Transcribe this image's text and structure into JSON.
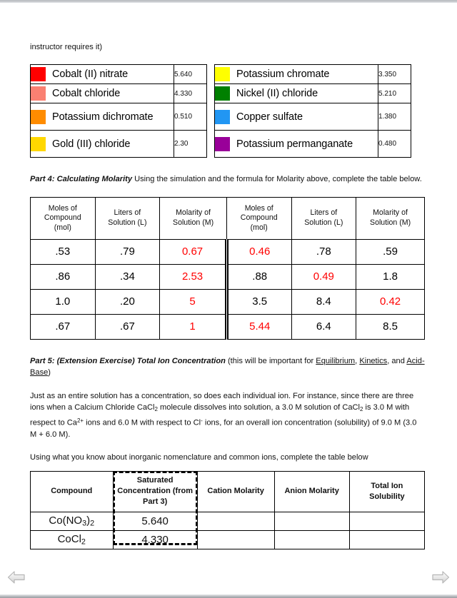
{
  "document": {
    "top_fragment_text": "instructor requires it)"
  },
  "legend_table": {
    "left_rows": [
      {
        "color": "#FF0000",
        "name": "Cobalt (II) nitrate",
        "value": "5.640",
        "tall": false
      },
      {
        "color": "#FA8072",
        "name": "Cobalt chloride",
        "value": "4.330",
        "tall": false
      },
      {
        "color": "#FF8C00",
        "name": "Potassium dichromate",
        "value": "0.510",
        "tall": true
      },
      {
        "color": "#FFD700",
        "name": "Gold (III) chloride",
        "value": "2.30",
        "tall": true
      }
    ],
    "right_rows": [
      {
        "color": "#FFFF00",
        "name": "Potassium chromate",
        "value": "3.350",
        "tall": false
      },
      {
        "color": "#008000",
        "name": "Nickel (II) chloride",
        "value": "5.210",
        "tall": false
      },
      {
        "color": "#2196F3",
        "name": "Copper sulfate",
        "value": "1.380",
        "tall": true
      },
      {
        "color": "#990099",
        "name": "Potassium permanganate",
        "value": "0.480",
        "tall": true
      }
    ]
  },
  "part4": {
    "heading": "Part 4: Calculating Molarity",
    "body": " Using the simulation and the formula for Molarity above, complete the table below.",
    "columns": [
      "Moles of Compound (mol)",
      "Liters of Solution (L)",
      "Molarity of Solution (M)",
      "Moles of Compound (mol)",
      "Liters of Solution (L)",
      "Molarity of Solution (M)"
    ],
    "column_lines": [
      [
        "Moles of",
        "Compound",
        "(mol)"
      ],
      [
        "Liters of",
        "Solution (L)"
      ],
      [
        "Molarity of",
        "Solution (M)"
      ],
      [
        "Moles of",
        "Compound",
        "(mol)"
      ],
      [
        "Liters of",
        "Solution (L)"
      ],
      [
        "Molarity of",
        "Solution (M)"
      ]
    ],
    "rows": [
      [
        {
          "v": ".53",
          "red": false
        },
        {
          "v": ".79",
          "red": false
        },
        {
          "v": "0.67",
          "red": true
        },
        {
          "v": "0.46",
          "red": true
        },
        {
          "v": ".78",
          "red": false
        },
        {
          "v": ".59",
          "red": false
        }
      ],
      [
        {
          "v": ".86",
          "red": false
        },
        {
          "v": ".34",
          "red": false
        },
        {
          "v": "2.53",
          "red": true
        },
        {
          "v": ".88",
          "red": false
        },
        {
          "v": "0.49",
          "red": true
        },
        {
          "v": "1.8",
          "red": false
        }
      ],
      [
        {
          "v": "1.0",
          "red": false
        },
        {
          "v": ".20",
          "red": false
        },
        {
          "v": "5",
          "red": true
        },
        {
          "v": "3.5",
          "red": false
        },
        {
          "v": "8.4",
          "red": false
        },
        {
          "v": "0.42",
          "red": true
        }
      ],
      [
        {
          "v": ".67",
          "red": false
        },
        {
          "v": ".67",
          "red": false
        },
        {
          "v": "1",
          "red": true
        },
        {
          "v": "5.44",
          "red": true
        },
        {
          "v": "6.4",
          "red": false
        },
        {
          "v": "8.5",
          "red": false
        }
      ]
    ],
    "red_color": "#FF0000"
  },
  "part5": {
    "heading": "Part 5: (Extension Exercise) Total Ion Concentration",
    "heading_tail_1": " (this will be important for ",
    "link_equilibrium": "Equilibrium",
    "sep_1": ", ",
    "link_kinetics": "Kinetics",
    "sep_2": ", and ",
    "link_acid_base": "Acid-Base",
    "heading_tail_2": ")",
    "paragraph_1_a": "Just as an entire solution has a concentration, so does each individual ion.  For instance, since there are three ions when a Calcium Chloride CaCl",
    "paragraph_1_sub1": "2",
    "paragraph_1_b": " molecule dissolves into solution, a 3.0 M solution of CaCl",
    "paragraph_1_sub2": "2",
    "paragraph_1_c": " is 3.0 M with respect to Ca",
    "paragraph_1_sup1": "2+",
    "paragraph_1_d": " ions and 6.0 M with respect to Cl",
    "paragraph_1_sup2": "-",
    "paragraph_1_e": " ions, for an overall ion concentration (solubility) of 9.0 M (3.0 M + 6.0 M).",
    "paragraph_2": "Using what you know about inorganic nomenclature and common ions, complete the table below",
    "table": {
      "columns": [
        "Compound",
        "Saturated Concentration (from Part 3)",
        "Cation Molarity",
        "Anion Molarity",
        "Total Ion Solubility"
      ],
      "column_lines": [
        [
          "Compound"
        ],
        [
          "Saturated",
          "Concentration (from",
          "Part 3)"
        ],
        [
          "Cation Molarity"
        ],
        [
          "Anion Molarity"
        ],
        [
          "Total Ion",
          "Solubility"
        ]
      ],
      "rows": [
        {
          "compound_base_1": "Co(NO",
          "compound_sub_1": "3",
          "compound_base_2": ")",
          "compound_sub_2": "2",
          "saturated": "5.640",
          "cation": "",
          "anion": "",
          "total": ""
        },
        {
          "compound_base_1": "CoCl",
          "compound_sub_1": "2",
          "compound_base_2": "",
          "compound_sub_2": "",
          "saturated": "4.330",
          "cation": "",
          "anion": "",
          "total": ""
        }
      ]
    }
  },
  "navigation": {
    "prev_label": "previous-page",
    "next_label": "next-page"
  }
}
